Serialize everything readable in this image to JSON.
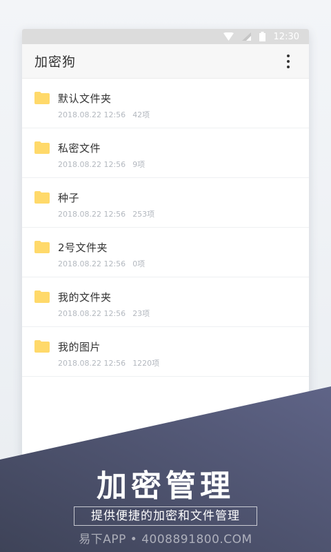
{
  "status_bar": {
    "time": "12:30"
  },
  "app_bar": {
    "title": "加密狗",
    "more_icon": "more-vertical-icon"
  },
  "folders": [
    {
      "name": "默认文件夹",
      "date": "2018.08.22 12:56",
      "count": "42项"
    },
    {
      "name": "私密文件",
      "date": "2018.08.22 12:56",
      "count": "9项"
    },
    {
      "name": "种子",
      "date": "2018.08.22 12:56",
      "count": "253项"
    },
    {
      "name": "2号文件夹",
      "date": "2018.08.22 12:56",
      "count": "0项"
    },
    {
      "name": "我的文件夹",
      "date": "2018.08.22 12:56",
      "count": "23项"
    },
    {
      "name": "我的图片",
      "date": "2018.08.22 12:56",
      "count": "1220项"
    }
  ],
  "promo": {
    "title": "加密管理",
    "subtitle": "提供便捷的加密和文件管理",
    "watermark": "易下APP • 4008891800.COM"
  },
  "colors": {
    "folder": "#ffd96a",
    "banner_dark": "#3e4358",
    "banner_light": "#5f6487"
  }
}
